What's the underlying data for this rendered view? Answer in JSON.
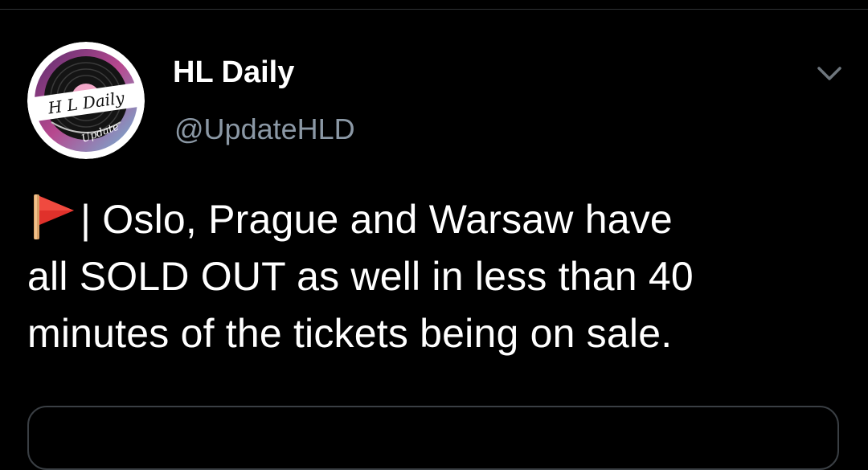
{
  "tweet": {
    "author": {
      "display_name": "HL Daily",
      "handle": "@UpdateHLD",
      "avatar_logo": {
        "line1": "H L Daily",
        "line2": "Update"
      }
    },
    "menu_icon": "chevron-down-icon",
    "flag_icon": "red-triangular-flag-icon",
    "text_lines": [
      "| Oslo, Prague and Warsaw have",
      "all SOLD OUT as well in less than 40",
      "minutes of the tickets being on sale."
    ]
  },
  "colors": {
    "background": "#000000",
    "text_primary": "#ffffff",
    "text_secondary": "#8b98a5",
    "divider": "#2f3336"
  }
}
